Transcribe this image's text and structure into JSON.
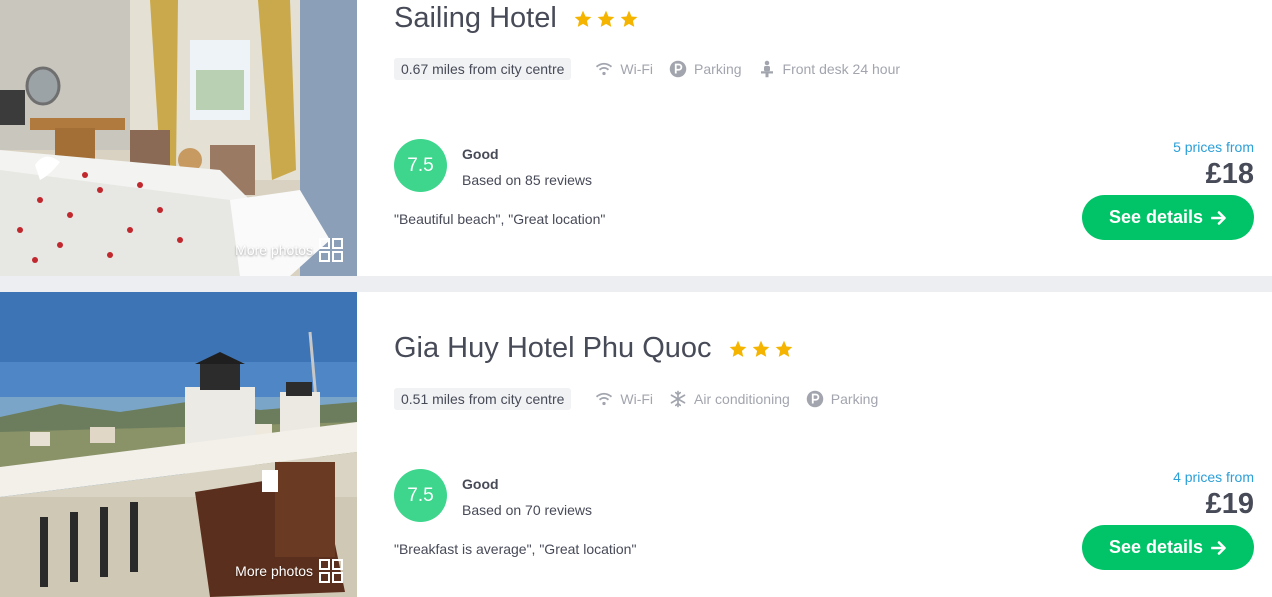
{
  "results": [
    {
      "name": "Sailing Hotel",
      "stars": 3,
      "more_photos": "More photos",
      "distance": "0.67 miles from city centre",
      "amenities": [
        {
          "label": "Wi-Fi",
          "icon": "wifi-icon"
        },
        {
          "label": "Parking",
          "icon": "parking-icon"
        },
        {
          "label": "Front desk 24 hour",
          "icon": "front-desk-icon"
        }
      ],
      "rating": "7.5",
      "rating_word": "Good",
      "reviews": "Based on 85 reviews",
      "quotes": "\"Beautiful beach\", \"Great location\"",
      "prices_from": "5 prices from",
      "price": "£18",
      "cta": "See details"
    },
    {
      "name": "Gia Huy Hotel Phu Quoc",
      "stars": 3,
      "more_photos": "More photos",
      "distance": "0.51 miles from city centre",
      "amenities": [
        {
          "label": "Wi-Fi",
          "icon": "wifi-icon"
        },
        {
          "label": "Air conditioning",
          "icon": "snowflake-icon"
        },
        {
          "label": "Parking",
          "icon": "parking-icon"
        }
      ],
      "rating": "7.5",
      "rating_word": "Good",
      "reviews": "Based on 70 reviews",
      "quotes": "\"Breakfast is average\", \"Great location\"",
      "prices_from": "4 prices from",
      "price": "£19",
      "cta": "See details"
    }
  ],
  "colors": {
    "rating_badge": "#3dd68c",
    "cta": "#00c467",
    "prices_from": "#2b9fd8",
    "star": "#f5b400",
    "amenity": "#a2a5ae"
  }
}
